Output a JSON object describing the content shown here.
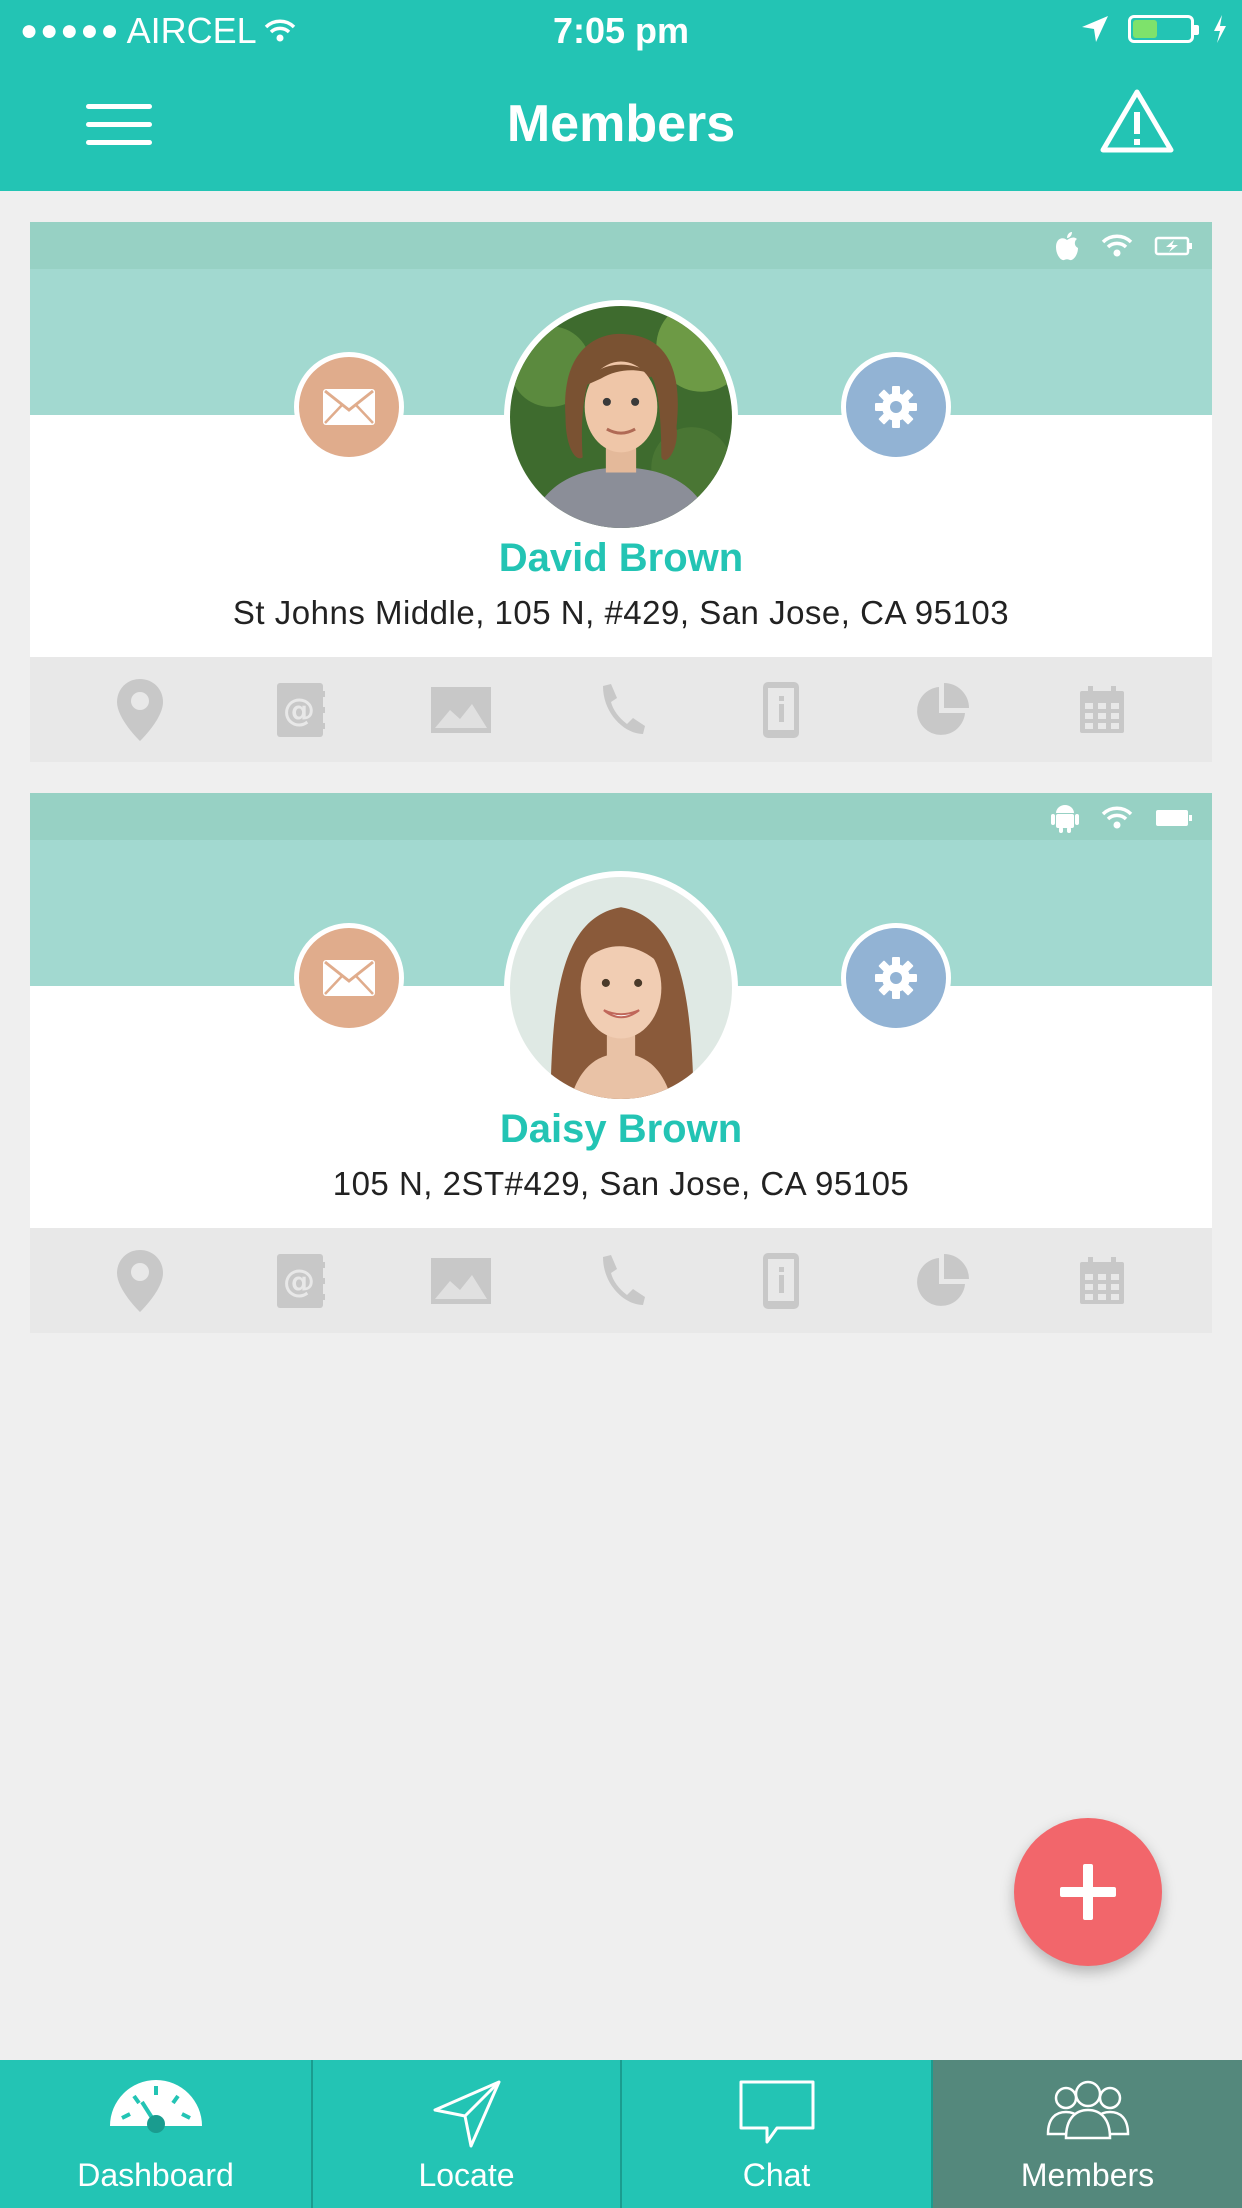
{
  "status_bar": {
    "signal": "●●●●●",
    "carrier": "AIRCEL",
    "time": "7:05 pm"
  },
  "header": {
    "title": "Members"
  },
  "members": [
    {
      "name": "David Brown",
      "address": "St Johns Middle, 105 N, #429, San Jose, CA 95103",
      "device": "apple"
    },
    {
      "name": "Daisy Brown",
      "address": "105 N, 2ST#429, San Jose, CA 95105",
      "device": "android"
    }
  ],
  "tabs": [
    {
      "label": "Dashboard",
      "icon": "dashboard-icon"
    },
    {
      "label": "Locate",
      "icon": "locate-icon"
    },
    {
      "label": "Chat",
      "icon": "chat-icon"
    },
    {
      "label": "Members",
      "icon": "members-icon",
      "active": true
    }
  ],
  "colors": {
    "brand": "#23c4b4",
    "banner": "#a2d9d0",
    "mail": "#e0ac8c",
    "settings": "#92b3d4",
    "fab": "#f2666b",
    "active_tab": "#54887c"
  }
}
